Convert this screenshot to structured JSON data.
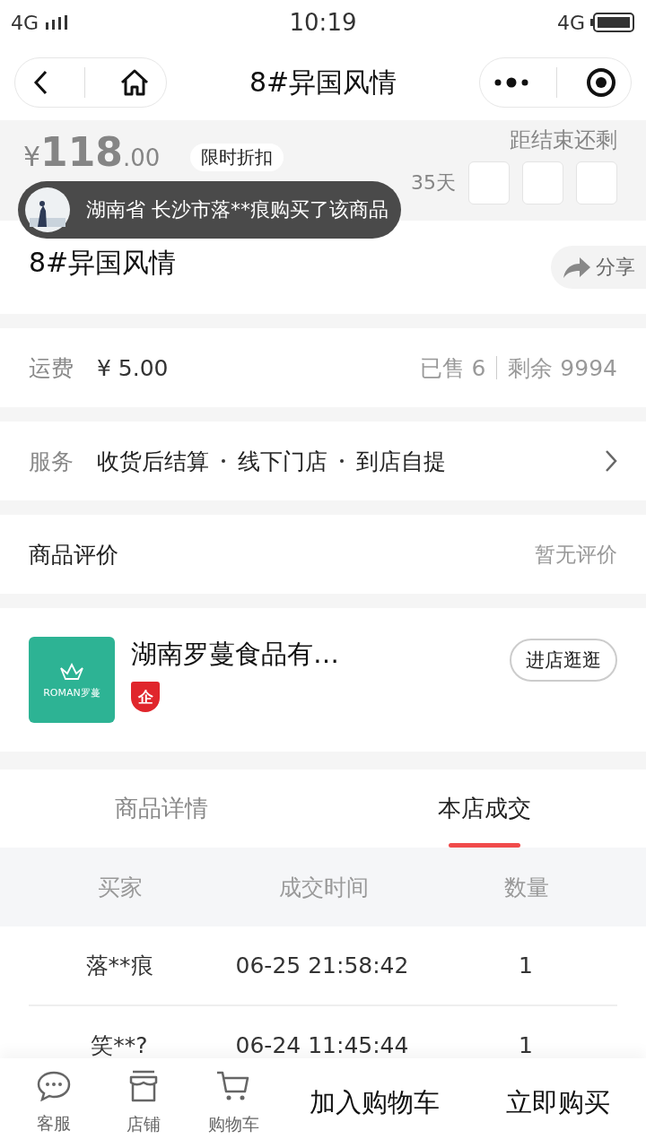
{
  "status_bar": {
    "network": "4G",
    "time": "10:19",
    "data_network": "4G"
  },
  "nav": {
    "title": "8#异国风情"
  },
  "promo": {
    "currency": "¥",
    "price": "118",
    "decimals": ".00",
    "badge": "限时折扣",
    "countdown_label": "距结束还剩",
    "days": "35天"
  },
  "toast": {
    "text": "湖南省 长沙市落**痕购买了该商品"
  },
  "product": {
    "title": "8#异国风情",
    "share": "分享"
  },
  "shipping": {
    "label": "运费",
    "fee": "¥ 5.00",
    "sold": "已售 6",
    "stock": "剩余 9994"
  },
  "service": {
    "label": "服务",
    "items": [
      "收货后结算",
      "线下门店",
      "到店自提"
    ]
  },
  "reviews": {
    "label": "商品评价",
    "empty": "暂无评价"
  },
  "store": {
    "name": "湖南罗蔓食品有…",
    "logo_text": "ROMAN罗蔓",
    "badge": "企",
    "button": "进店逛逛"
  },
  "tabs": [
    {
      "label": "商品详情",
      "selected": false
    },
    {
      "label": "本店成交",
      "selected": true
    }
  ],
  "table": {
    "columns": [
      "买家",
      "成交时间",
      "数量"
    ],
    "rows": [
      [
        "落**痕",
        "06-25 21:58:42",
        "1"
      ],
      [
        "笑**?",
        "06-24 11:45:44",
        "1"
      ]
    ]
  },
  "bottom_bar": {
    "icons": [
      {
        "kind": "chat",
        "label": "客服"
      },
      {
        "kind": "store",
        "label": "店铺"
      },
      {
        "kind": "cart",
        "label": "购物车"
      }
    ],
    "buttons": [
      "加入购物车",
      "立即购买"
    ]
  }
}
